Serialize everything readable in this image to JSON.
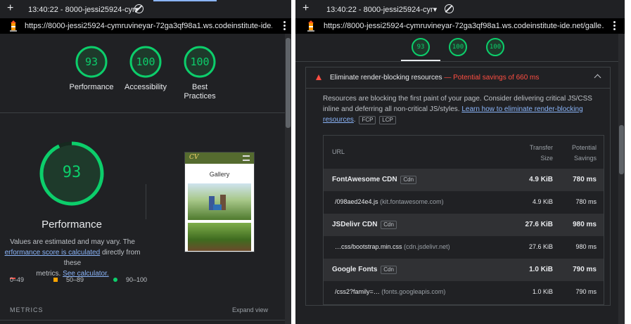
{
  "left": {
    "tab": {
      "time_label": "13:40:22 - 8000-jessi25924-cyr▾"
    },
    "url": "https://8000-jessi25924-cymruvineyar-72ga3qf98a1.ws.codeinstitute-ide.net/galle…",
    "scores": [
      {
        "value": "93",
        "label": "Performance",
        "score": 93
      },
      {
        "value": "100",
        "label": "Accessibility",
        "score": 100
      },
      {
        "value": "100",
        "label_line1": "Best",
        "label_line2": "Practices",
        "score": 100
      }
    ],
    "big_gauge": {
      "value": "93",
      "label": "Performance",
      "score": 93
    },
    "note": {
      "line1": "Values are estimated and may vary. The",
      "link1": "erformance score is calculated",
      "line2_rest": " directly from these",
      "line3": "metrics. ",
      "link2": "See calculator."
    },
    "legend": [
      {
        "range": "0–49",
        "color": "#ff4e42"
      },
      {
        "range": "50–89",
        "color": "#ffa400"
      },
      {
        "range": "90–100",
        "color": "#0cce6b"
      }
    ],
    "metrics_label": "METRICS",
    "expand_label": "Expand view",
    "thumbnail": {
      "logo_text": "CV",
      "heading": "Gallery"
    }
  },
  "right": {
    "tab": {
      "time_label": "13:40:22 - 8000-jessi25924-cyr▾"
    },
    "url": "https://8000-jessi25924-cymruvineyar-72ga3qf98a1.ws.codeinstitute-ide.net/galle…",
    "scores": [
      {
        "value": "93",
        "score": 93
      },
      {
        "value": "100",
        "score": 100
      },
      {
        "value": "100",
        "score": 100
      }
    ],
    "audit": {
      "title": "Eliminate render-blocking resources",
      "savings": "— Potential savings of 660 ms",
      "desc_text": "Resources are blocking the first paint of your page. Consider delivering critical JS/CSS inline and deferring all non-critical JS/styles. ",
      "desc_link": "Learn how to eliminate render-blocking resources",
      "desc_end": ".",
      "tags": [
        "FCP",
        "LCP"
      ],
      "columns": {
        "url": "URL",
        "transfer": "Transfer Size",
        "savings": "Potential Savings"
      },
      "rows": [
        {
          "kind": "group",
          "name": "FontAwesome CDN",
          "tag": "Cdn",
          "size": "4.9 KiB",
          "savings": "780 ms"
        },
        {
          "kind": "sub",
          "name": "/098aed24e4.js",
          "origin": "(kit.fontawesome.com)",
          "size": "4.9 KiB",
          "savings": "780 ms"
        },
        {
          "kind": "group",
          "name": "JSDelivr CDN",
          "tag": "Cdn",
          "size": "27.6 KiB",
          "savings": "980 ms"
        },
        {
          "kind": "sub",
          "name": "…css/bootstrap.min.css",
          "origin": "(cdn.jsdelivr.net)",
          "size": "27.6 KiB",
          "savings": "980 ms"
        },
        {
          "kind": "group",
          "name": "Google Fonts",
          "tag": "Cdn",
          "size": "1.0 KiB",
          "savings": "790 ms"
        },
        {
          "kind": "sub",
          "name": "/css2?family=…",
          "origin": "(fonts.googleapis.com)",
          "size": "1.0 KiB",
          "savings": "790 ms"
        }
      ]
    }
  },
  "colors": {
    "pass": "#0cce6b",
    "average": "#ffa400",
    "fail": "#ff4e42",
    "link": "#8ab4f8",
    "panel_bg": "#202124"
  }
}
